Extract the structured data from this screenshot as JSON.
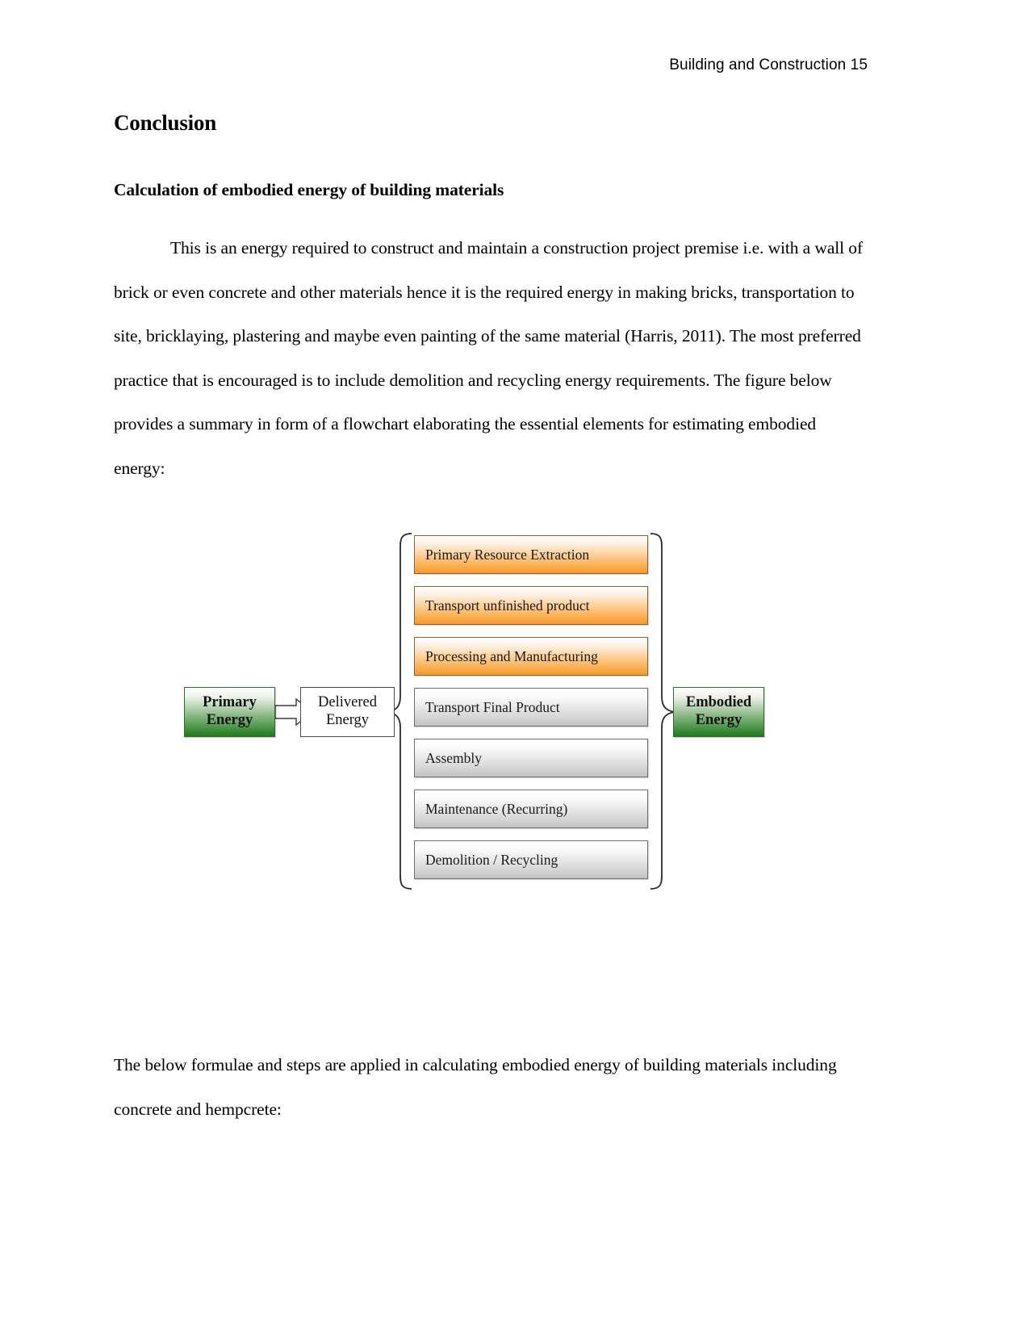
{
  "header": {
    "running_head": "Building and Construction 15"
  },
  "document": {
    "section_title": "Conclusion",
    "sub_title": "Calculation of embodied energy of building materials",
    "paragraph_1": "This is an energy required to construct and maintain a construction project premise i.e. with a wall of brick or even concrete and other materials hence it is the required energy in making bricks, transportation to site, bricklaying, plastering and maybe even painting of the same material (Harris, 2011). The most preferred practice that is encouraged is to include demolition and recycling energy requirements. The figure below provides a summary in form of a flowchart elaborating the essential elements for estimating embodied energy:",
    "paragraph_2": "The below formulae and steps are applied in calculating embodied energy of building materials including concrete and hempcrete:"
  },
  "figure": {
    "primary_energy": {
      "line1": "Primary",
      "line2": "Energy"
    },
    "delivered_energy": {
      "line1": "Delivered",
      "line2": "Energy"
    },
    "embodied_energy": {
      "line1": "Embodied",
      "line2": "Energy"
    },
    "stages": [
      {
        "label": "Primary Resource Extraction",
        "fill": "orange"
      },
      {
        "label": "Transport unfinished product",
        "fill": "orange"
      },
      {
        "label": "Processing and Manufacturing",
        "fill": "orange"
      },
      {
        "label": "Transport Final Product",
        "fill": "gray"
      },
      {
        "label": "Assembly",
        "fill": "gray"
      },
      {
        "label": "Maintenance (Recurring)",
        "fill": "gray"
      },
      {
        "label": "Demolition / Recycling",
        "fill": "gray"
      }
    ],
    "colors": {
      "orange_accent": "#f79a29",
      "gray_accent": "#c2c2c2",
      "green_accent": "#1f7a1f"
    }
  }
}
